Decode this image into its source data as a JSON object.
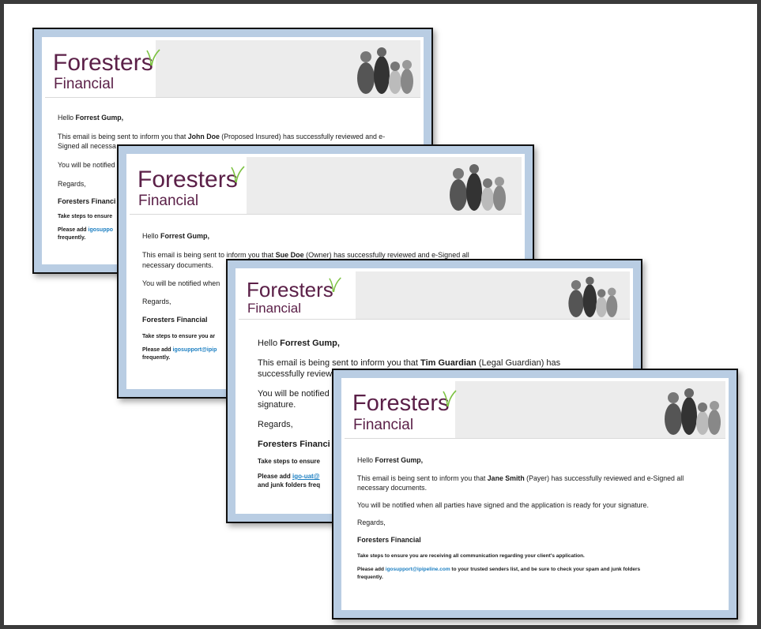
{
  "brand": {
    "name": "Foresters",
    "sub": "Financial",
    "purple": "#5b2048",
    "green": "#7cc242"
  },
  "emails": [
    {
      "greeting_prefix": "Hello ",
      "recipient": "Forrest Gump,",
      "intro_prefix": "This email is being sent to inform you that ",
      "party_name": "John Doe",
      "party_role_suffix": " (Proposed Insured) has successfully reviewed and e-",
      "line2": "Signed all necessa",
      "notified": "You will be notified",
      "regards": "Regards,",
      "signature": "Foresters Financi",
      "tip": "Take steps to ensure",
      "add_prefix": "Please add ",
      "add_link": "igosuppo",
      "add_cont": "frequently."
    },
    {
      "greeting_prefix": "Hello ",
      "recipient": "Forrest Gump,",
      "intro_prefix": "This email is being sent to inform you that ",
      "party_name": "Sue Doe",
      "party_role_suffix": " (Owner) has successfully reviewed and e-Signed all",
      "line2": "necessary documents.",
      "notified": "You will be notified when",
      "regards": "Regards,",
      "signature": "Foresters Financial",
      "tip": "Take steps to ensure you ar",
      "add_prefix": "Please add ",
      "add_link": "igosupport@ipip",
      "add_cont": "frequently."
    },
    {
      "greeting_prefix": "Hello ",
      "recipient": "Forrest Gump,",
      "intro_prefix": "This email is being sent to inform you that ",
      "party_name": "Tim Guardian",
      "party_role_suffix": " (Legal Guardian) has",
      "line2": "successfully review",
      "notified": "You will be notified",
      "notified2": "signature.",
      "regards": "Regards,",
      "signature": "Foresters Financi",
      "tip": "Take steps to ensure",
      "add_prefix": "Please add ",
      "add_link": "igo-uat@",
      "add_cont": "and junk folders freq"
    },
    {
      "greeting_prefix": "Hello ",
      "recipient": "Forrest Gump,",
      "intro_prefix": "This email is being sent to inform you that ",
      "party_name": "Jane Smith",
      "party_role_suffix": " (Payer) has successfully reviewed and e-Signed all",
      "line2": "necessary documents.",
      "notified": "You will be notified when all parties have signed and the application is ready for your signature.",
      "regards": "Regards,",
      "signature": "Foresters Financial",
      "tip": "Take steps to ensure you are receiving all communication regarding your client's application.",
      "add_prefix": "Please add ",
      "add_link": "igosupport@ipipeline.com",
      "add_suffix": " to your trusted senders list, and be sure to check your spam and junk folders",
      "add_cont": "frequently."
    }
  ]
}
